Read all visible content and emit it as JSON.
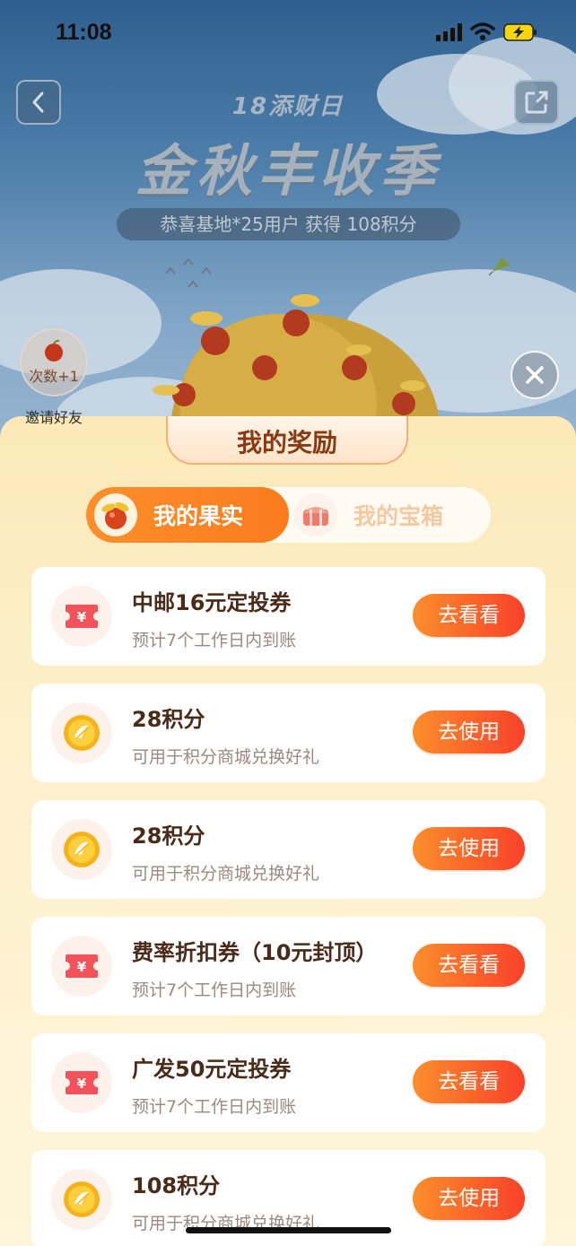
{
  "status_bar": {
    "time": "11:08",
    "signal_icon": "cellular-signal-icon",
    "wifi_icon": "wifi-icon",
    "battery_icon": "battery-charging-icon"
  },
  "header": {
    "event_subtitle": "18添财日",
    "event_title": "金秋丰收季",
    "winner_notice": "恭喜基地*25用户 获得 108积分"
  },
  "invite": {
    "count_label": "次数+1",
    "label": "邀请好友"
  },
  "sheet": {
    "title": "我的奖励",
    "tabs": [
      {
        "label": "我的果实",
        "active": true
      },
      {
        "label": "我的宝箱",
        "active": false
      }
    ],
    "rewards": [
      {
        "icon": "coupon-ticket-icon",
        "title": "中邮16元定投券",
        "subtitle": "预计7个工作日内到账",
        "action": "去看看"
      },
      {
        "icon": "points-coin-icon",
        "title": "28积分",
        "subtitle": "可用于积分商城兑换好礼",
        "action": "去使用"
      },
      {
        "icon": "points-coin-icon",
        "title": "28积分",
        "subtitle": "可用于积分商城兑换好礼",
        "action": "去使用"
      },
      {
        "icon": "coupon-ticket-icon",
        "title": "费率折扣券（10元封顶）",
        "subtitle": "预计7个工作日内到账",
        "action": "去看看"
      },
      {
        "icon": "coupon-ticket-icon",
        "title": "广发50元定投券",
        "subtitle": "预计7个工作日内到账",
        "action": "去看看"
      },
      {
        "icon": "points-coin-icon",
        "title": "108积分",
        "subtitle": "可用于积分商城兑换好礼",
        "action": "去使用"
      }
    ]
  },
  "colors": {
    "accent_orange": "#fb7c1c",
    "button_red": "#f9412a",
    "title_brown": "#8a3a12",
    "sheet_bg": "#fdf0cb"
  }
}
